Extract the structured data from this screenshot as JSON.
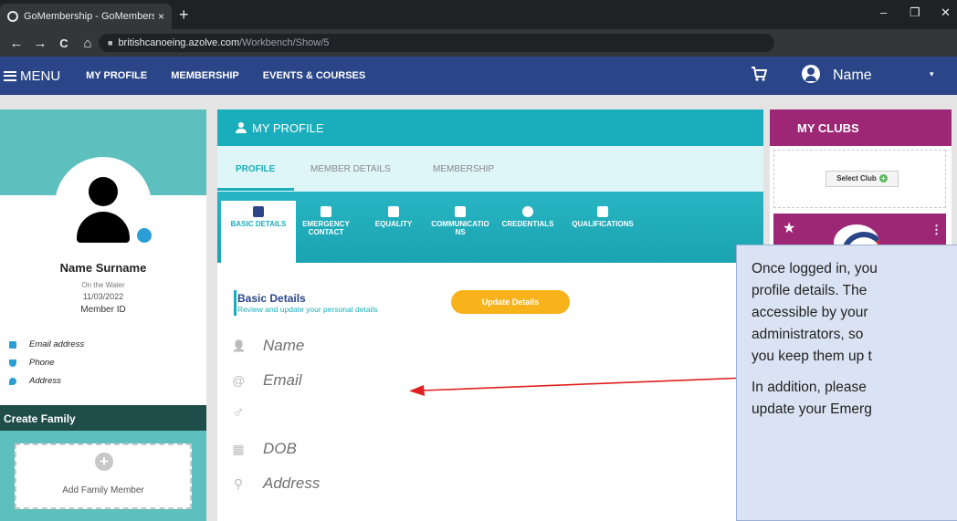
{
  "browser": {
    "tab_title": "GoMembership - GoMembership",
    "tab_close": "×",
    "new_tab": "+",
    "url_host": "britishcanoeing.azolve.com",
    "url_path": "/Workbench/Show/5",
    "minimize": "–",
    "restore": "❐",
    "close": "✕",
    "back": "←",
    "forward": "→",
    "reload": "C",
    "home": "⌂"
  },
  "nav": {
    "menu_label": "MENU",
    "links": [
      "MY PROFILE",
      "MEMBERSHIP",
      "EVENTS & COURSES"
    ],
    "user_name": "Name",
    "caret": "▾"
  },
  "profile_card": {
    "name": "Name Surname",
    "status": "On the Water",
    "date": "11/03/2022",
    "member_id_label": "Member ID",
    "contacts": [
      "Email address",
      "Phone",
      "Address"
    ],
    "create_family": "Create Family",
    "add_family_member": "Add Family Member",
    "plus": "+"
  },
  "my_profile": {
    "header": "MY PROFILE",
    "tabs": [
      "PROFILE",
      "MEMBER DETAILS",
      "MEMBERSHIP"
    ],
    "icon_tabs": [
      {
        "line1": "BASIC DETAILS",
        "line2": ""
      },
      {
        "line1": "EMERGENCY",
        "line2": "CONTACT"
      },
      {
        "line1": "EQUALITY",
        "line2": ""
      },
      {
        "line1": "COMMUNICATIO",
        "line2": "NS"
      },
      {
        "line1": "CREDENTIALS",
        "line2": ""
      },
      {
        "line1": "QUALIFICATIONS",
        "line2": ""
      }
    ],
    "section_title": "Basic Details",
    "section_subtitle": "Review and update your personal details",
    "update_button": "Update Details",
    "fields": [
      {
        "icon": "person-icon",
        "glyph": "👤",
        "value": "Name"
      },
      {
        "icon": "at-icon",
        "glyph": "@",
        "value": "Email"
      },
      {
        "icon": "gender-icon",
        "glyph": "♂",
        "value": ""
      },
      {
        "icon": "calendar-icon",
        "glyph": "▦",
        "value": "DOB"
      },
      {
        "icon": "location-icon",
        "glyph": "⚲",
        "value": "Address"
      }
    ]
  },
  "clubs": {
    "header": "MY CLUBS",
    "select_club": "Select Club",
    "plus": "+",
    "star": "★",
    "dots": "⋮"
  },
  "callout": {
    "lines": [
      "Once logged in, you",
      "profile details.  The",
      "accessible by your",
      "administrators, so",
      "you keep them up t"
    ],
    "lines2": [
      "In addition, please",
      "update your Emerg"
    ]
  },
  "colors": {
    "nav_blue": "#2b4688",
    "teal": "#1aaebc",
    "club_magenta": "#9d2775",
    "update_yellow": "#f8b31b",
    "arrow_red": "#e02020"
  }
}
